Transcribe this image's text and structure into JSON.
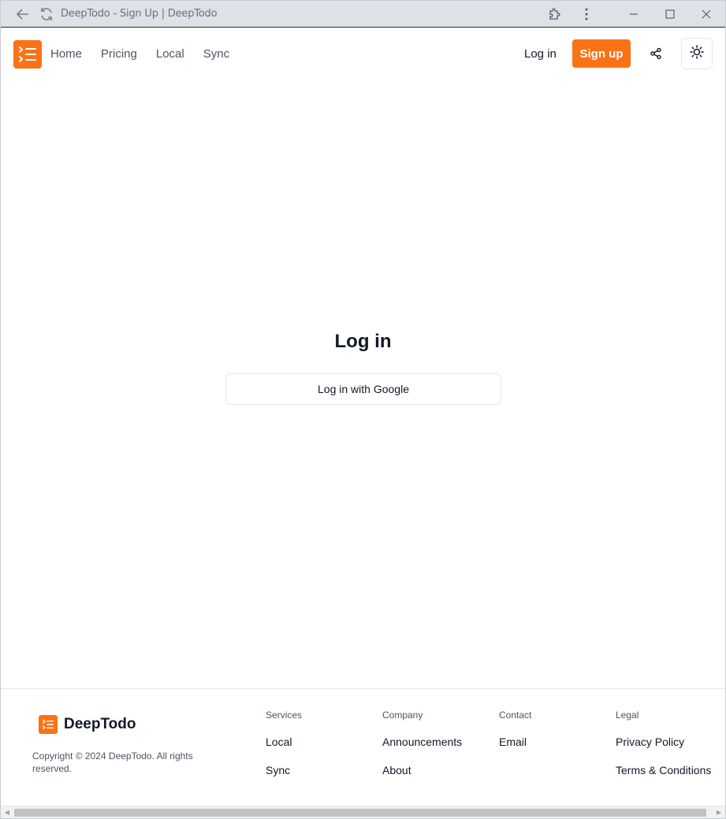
{
  "browser": {
    "title": "DeepTodo - Sign Up | DeepTodo"
  },
  "header": {
    "nav": [
      {
        "label": "Home"
      },
      {
        "label": "Pricing"
      },
      {
        "label": "Local"
      },
      {
        "label": "Sync"
      }
    ],
    "login_label": "Log in",
    "signup_label": "Sign up"
  },
  "main": {
    "title": "Log in",
    "google_button": "Log in with Google"
  },
  "footer": {
    "brand": "DeepTodo",
    "copyright": "Copyright © 2024 DeepTodo. All rights reserved.",
    "columns": [
      {
        "heading": "Services",
        "links": [
          "Local",
          "Sync"
        ]
      },
      {
        "heading": "Company",
        "links": [
          "Announcements",
          "About"
        ]
      },
      {
        "heading": "Contact",
        "links": [
          "Email"
        ]
      },
      {
        "heading": "Legal",
        "links": [
          "Privacy Policy",
          "Terms & Conditions"
        ]
      }
    ]
  },
  "colors": {
    "accent": "#f97316",
    "text": "#111827",
    "muted": "#4b5563",
    "border": "#e5e7eb",
    "chrome_bg": "#dee1e6"
  },
  "icons": {
    "logo": "list-todo-icon",
    "share": "share-icon",
    "theme": "sun-icon"
  }
}
